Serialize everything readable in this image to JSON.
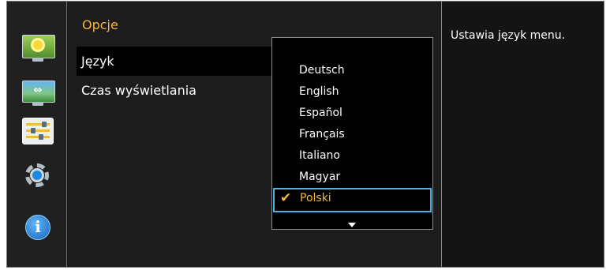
{
  "menu": {
    "title": "Opcje",
    "items": [
      {
        "label": "Język",
        "selected": true
      },
      {
        "label": "Czas wyświetlania",
        "selected": false
      }
    ]
  },
  "languages": {
    "options": [
      "Deutsch",
      "English",
      "Español",
      "Français",
      "Italiano",
      "Magyar",
      "Polski"
    ],
    "selected": "Polski",
    "check_icon": "checkmark-icon",
    "scroll_icon": "triangle-down-icon"
  },
  "help": {
    "text": "Ustawia język menu."
  },
  "sidebar": {
    "icons": [
      "picture-icon",
      "size-position-icon",
      "setup-icon",
      "system-gear-icon",
      "information-icon"
    ],
    "selected": "setup-icon"
  },
  "colors": {
    "accent": "#f6b73c",
    "highlight": "#44b4e6",
    "background": "#1c1c1c"
  }
}
